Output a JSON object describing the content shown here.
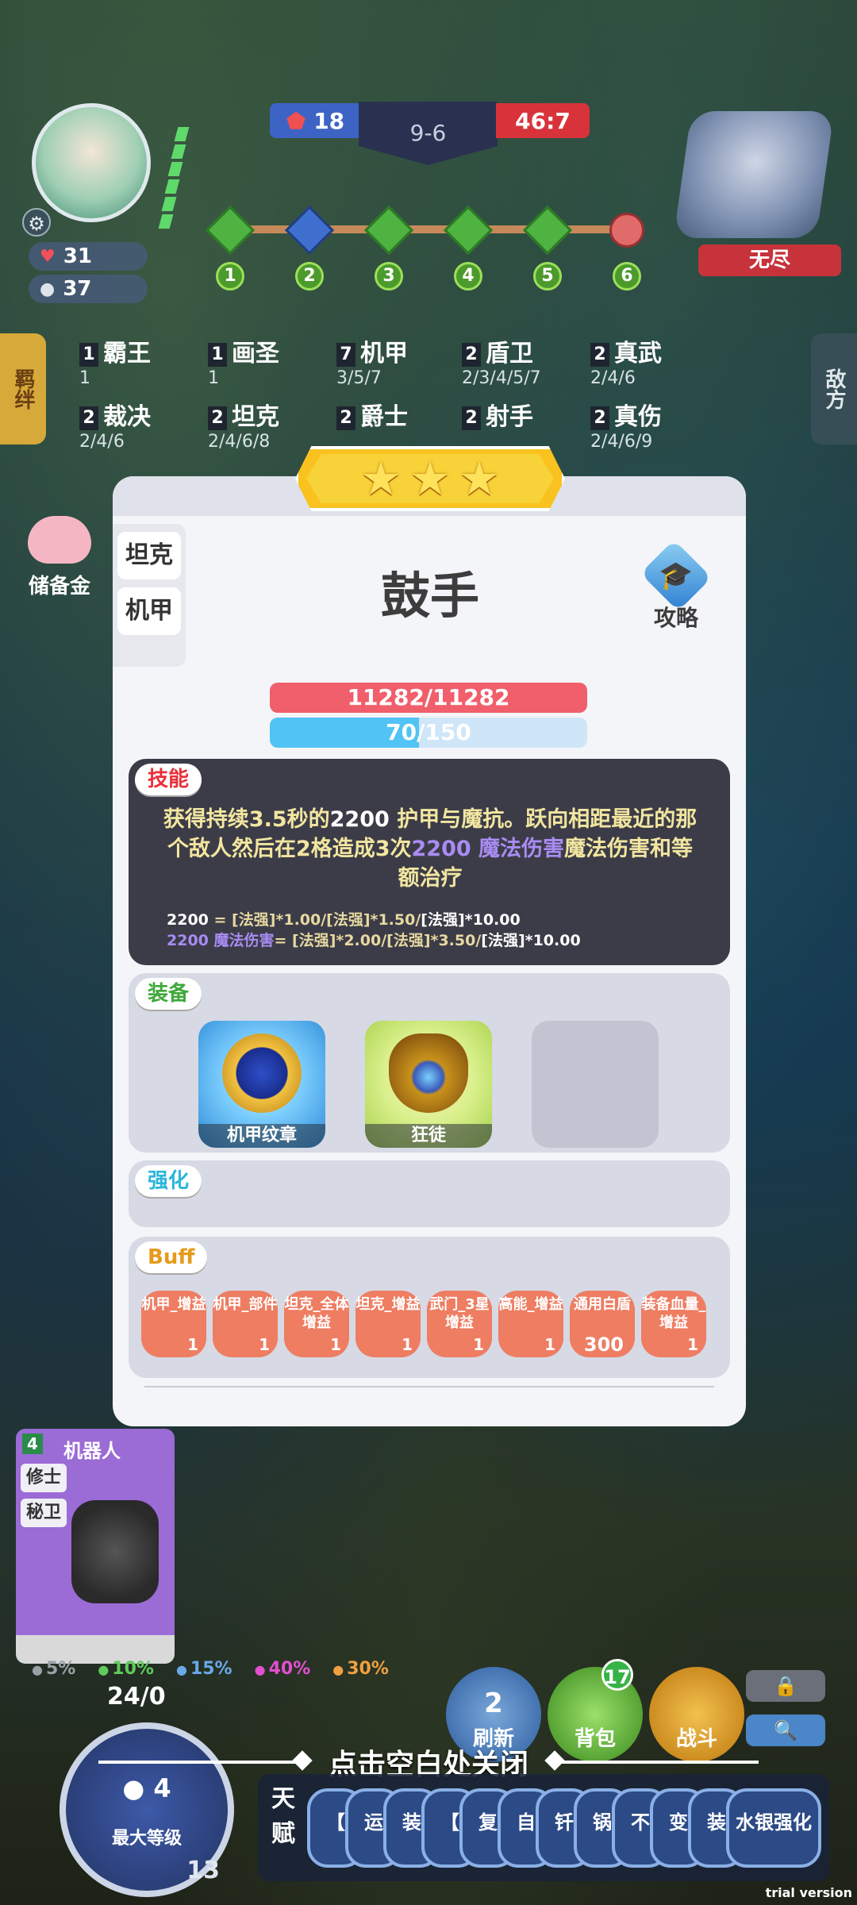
{
  "hud": {
    "hp": "31",
    "coins": "37",
    "score_left": "18",
    "round": "9-6",
    "score_right": "46:7",
    "stages": [
      "1",
      "2",
      "3",
      "4",
      "5",
      "6"
    ],
    "enemy_label": "无尽",
    "left_tab": "羁绊",
    "right_tab": "敌方",
    "piggy_label": "储备金"
  },
  "traits": [
    {
      "n": "1",
      "name": "霸王",
      "sub": "1"
    },
    {
      "n": "1",
      "name": "画圣",
      "sub": "1"
    },
    {
      "n": "7",
      "name": "机甲",
      "sub": "3/5/7"
    },
    {
      "n": "2",
      "name": "盾卫",
      "sub": "2/3/4/5/7"
    },
    {
      "n": "2",
      "name": "真武",
      "sub": "2/4/6"
    },
    {
      "n": "2",
      "name": "裁决",
      "sub": "2/4/6"
    },
    {
      "n": "2",
      "name": "坦克",
      "sub": "2/4/6/8"
    },
    {
      "n": "2",
      "name": "爵士",
      "sub": ""
    },
    {
      "n": "2",
      "name": "射手",
      "sub": ""
    },
    {
      "n": "2",
      "name": "真伤",
      "sub": "2/4/6/9"
    }
  ],
  "modal": {
    "stars": 3,
    "trait_tags": [
      "坦克",
      "机甲"
    ],
    "unit_name": "鼓手",
    "guide_label": "攻略",
    "hp_text": "11282/11282",
    "mana_text": "70/150",
    "mana_fraction": 0.47,
    "skill": {
      "tag": "技能",
      "desc_a": "获得持续3.5秒的",
      "desc_b": "2200",
      "desc_c": " 护甲与魔抗。跃向相距最近的那个敌人然后在2格造成3次",
      "desc_d": "2200 魔法伤害",
      "desc_e": "魔法伤害和等额治疗",
      "formula1_a": "2200",
      "formula1_b": " = [法强]*1.00/[法强]*1.50/",
      "formula1_c": "[法强]*10.00",
      "formula2_a": "2200 魔法伤害",
      "formula2_b": "= [法强]*2.00/[法强]*3.50/",
      "formula2_c": "[法强]*10.00"
    },
    "equip": {
      "tag": "装备",
      "items": [
        "机甲纹章",
        "狂徒"
      ]
    },
    "strengthen_tag": "强化",
    "buff": {
      "tag": "Buff",
      "items": [
        {
          "label": "机甲_增益",
          "count": "1"
        },
        {
          "label": "机甲_部件",
          "count": "1"
        },
        {
          "label": "坦克_全体增益",
          "count": "1"
        },
        {
          "label": "坦克_增益",
          "count": "1"
        },
        {
          "label": "武门_3星增益",
          "count": "1"
        },
        {
          "label": "高能_增益",
          "count": "1"
        },
        {
          "label": "通用白盾",
          "count": "300"
        },
        {
          "label": "装备血量_增益",
          "count": "1"
        }
      ]
    }
  },
  "bottom": {
    "robot_cost": "4",
    "robot_name": "机器人",
    "robot_tags": [
      "修士",
      "秘卫"
    ],
    "odds": [
      "5%",
      "10%",
      "15%",
      "40%",
      "30%"
    ],
    "xp": "24/0",
    "coin_cost": "4",
    "level_text": "最大等级",
    "level_num": "13",
    "refresh_cost": "2",
    "refresh_label": "刷新",
    "bag_label": "背包",
    "bag_badge": "17",
    "fight_label": "战斗",
    "close_hint": "点击空白处关闭",
    "talent_label": "天赋",
    "talents": [
      "【",
      "运",
      "装",
      "【",
      "复",
      "自",
      "钎",
      "锅",
      "不",
      "变",
      "装",
      "水银强化"
    ],
    "trial": "trial version"
  }
}
